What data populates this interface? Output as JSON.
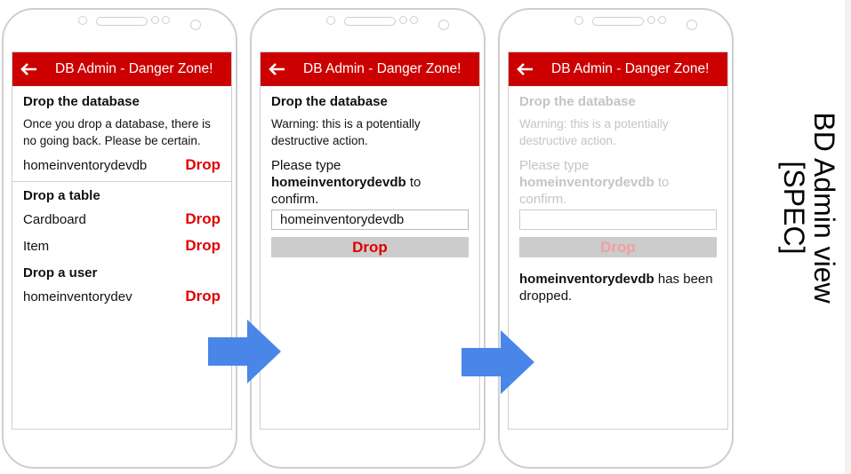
{
  "app": {
    "title": "DB Admin - Danger Zone!"
  },
  "screen1": {
    "section_db": "Drop the database",
    "db_text": "Once you drop a database, there is no going back. Please be certain.",
    "db_name": "homeinventorydevdb",
    "section_table": "Drop a table",
    "tables": [
      {
        "name": "Cardboard"
      },
      {
        "name": "Item"
      }
    ],
    "section_user": "Drop a user",
    "user_name": "homeinventorydev",
    "drop_label": "Drop"
  },
  "screen2": {
    "heading": "Drop the database",
    "warning": "Warning: this is a potentially destructive action.",
    "prompt_pre": "Please type",
    "prompt_name": "homeinventorydevdb",
    "prompt_post": "to",
    "prompt_end": "confirm.",
    "input_value": "homeinventorydevdb",
    "button": "Drop"
  },
  "screen3": {
    "heading": "Drop the database",
    "warning": "Warning: this is a potentially destructive action.",
    "prompt_pre": "Please type",
    "prompt_name": "homeinventorydevdb",
    "prompt_post": "to",
    "prompt_end": "confirm.",
    "input_value": "",
    "button": "Drop",
    "result_name": "homeinventorydevdb",
    "result_text": "has been dropped."
  },
  "label": {
    "line1": "BD Admin view",
    "line2": "[SPEC]"
  },
  "colors": {
    "accent": "#cc0000",
    "drop_text": "#e00000",
    "arrow": "#4a86e8"
  }
}
